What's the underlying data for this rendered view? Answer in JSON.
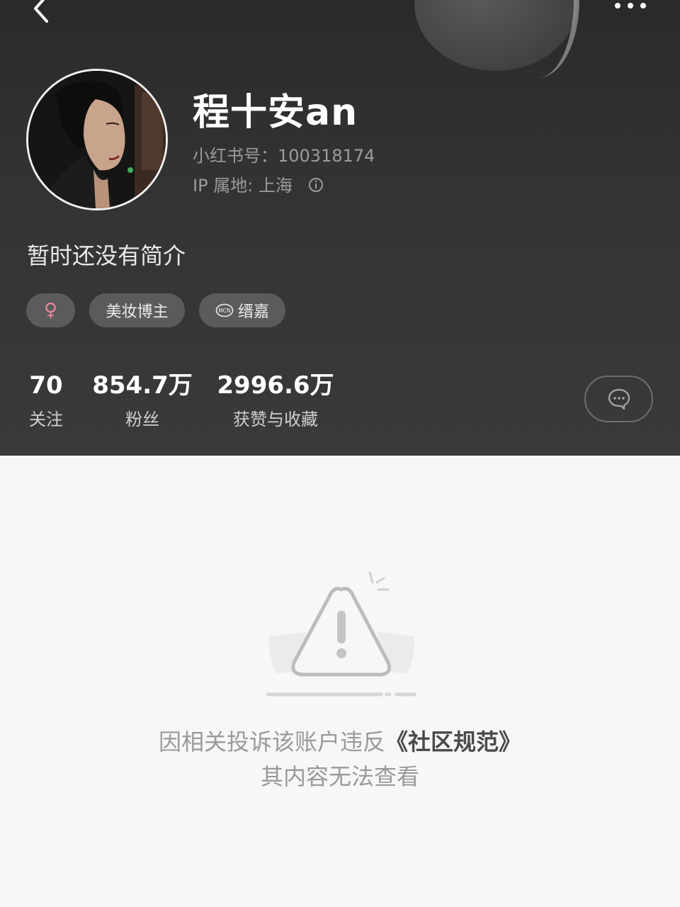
{
  "profile": {
    "name": "程十安an",
    "id_label": "小红书号：100318174",
    "ip_label": "IP 属地: 上海",
    "bio": "暂时还没有简介",
    "tags": {
      "gender": "♀",
      "role": "美妆博主",
      "mcn": "缙嘉"
    }
  },
  "stats": {
    "following": {
      "value": "70",
      "label": "关注"
    },
    "fans": {
      "value": "854.7万",
      "label": "粉丝"
    },
    "likes": {
      "value": "2996.6万",
      "label": "获赞与收藏"
    }
  },
  "notice": {
    "line1_text": "因相关投诉该账户违反",
    "line1_link": "《社区规范》",
    "line2": "其内容无法查看"
  },
  "colors": {
    "header_bg": "#333333",
    "gender_pink": "#e4879b",
    "notice_text": "#9a9a9a"
  },
  "icons": {
    "back": "chevron-left-icon",
    "more": "more-dots-icon",
    "info": "info-circle-icon",
    "mcn": "mcn-badge-icon",
    "chat": "chat-bubble-icon",
    "warning": "warning-triangle-icon"
  }
}
